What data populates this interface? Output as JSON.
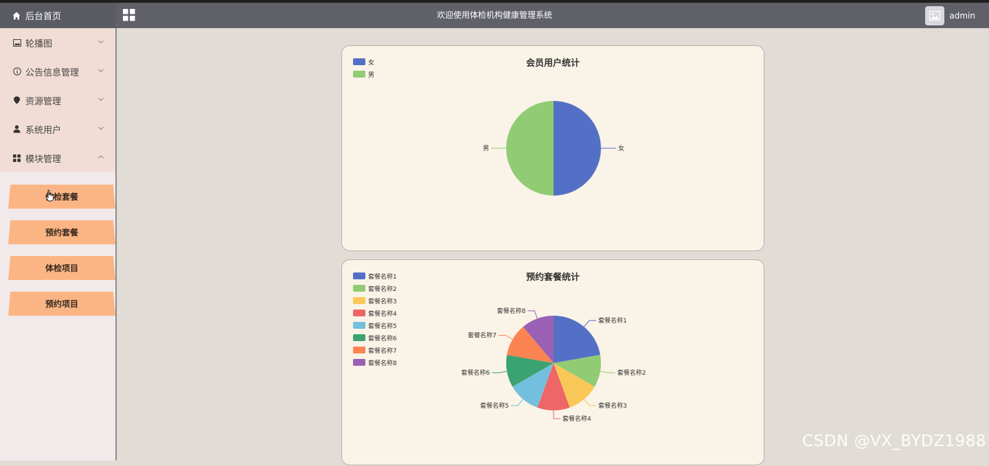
{
  "header": {
    "home_label": "后台首页",
    "title": "欢迎使用体检机构健康管理系统",
    "username": "admin"
  },
  "sidebar": {
    "items": [
      {
        "label": "轮播图",
        "icon": "picture-icon",
        "expanded": false
      },
      {
        "label": "公告信息管理",
        "icon": "info-icon",
        "expanded": false
      },
      {
        "label": "资源管理",
        "icon": "location-icon",
        "expanded": false
      },
      {
        "label": "系统用户",
        "icon": "user-icon",
        "expanded": false
      },
      {
        "label": "模块管理",
        "icon": "grid-icon",
        "expanded": true
      }
    ],
    "submenu": [
      "体检套餐",
      "预约套餐",
      "体检项目",
      "预约项目"
    ]
  },
  "charts": {
    "colors": [
      "#5470c6",
      "#91cc75",
      "#fac858",
      "#ee6666",
      "#73c0de",
      "#3ba272",
      "#fc8452",
      "#9a60b4"
    ]
  },
  "chart_data": [
    {
      "type": "pie",
      "title": "会员用户统计",
      "categories": [
        "女",
        "男"
      ],
      "values": [
        1,
        1
      ],
      "legend": "top-left"
    },
    {
      "type": "pie",
      "title": "预约套餐统计",
      "categories": [
        "套餐名称1",
        "套餐名称2",
        "套餐名称3",
        "套餐名称4",
        "套餐名称5",
        "套餐名称6",
        "套餐名称7",
        "套餐名称8"
      ],
      "values": [
        4,
        2,
        2,
        2,
        2,
        2,
        2,
        2
      ],
      "legend": "top-left"
    }
  ],
  "watermark": "CSDN @VX_BYDZ1988"
}
